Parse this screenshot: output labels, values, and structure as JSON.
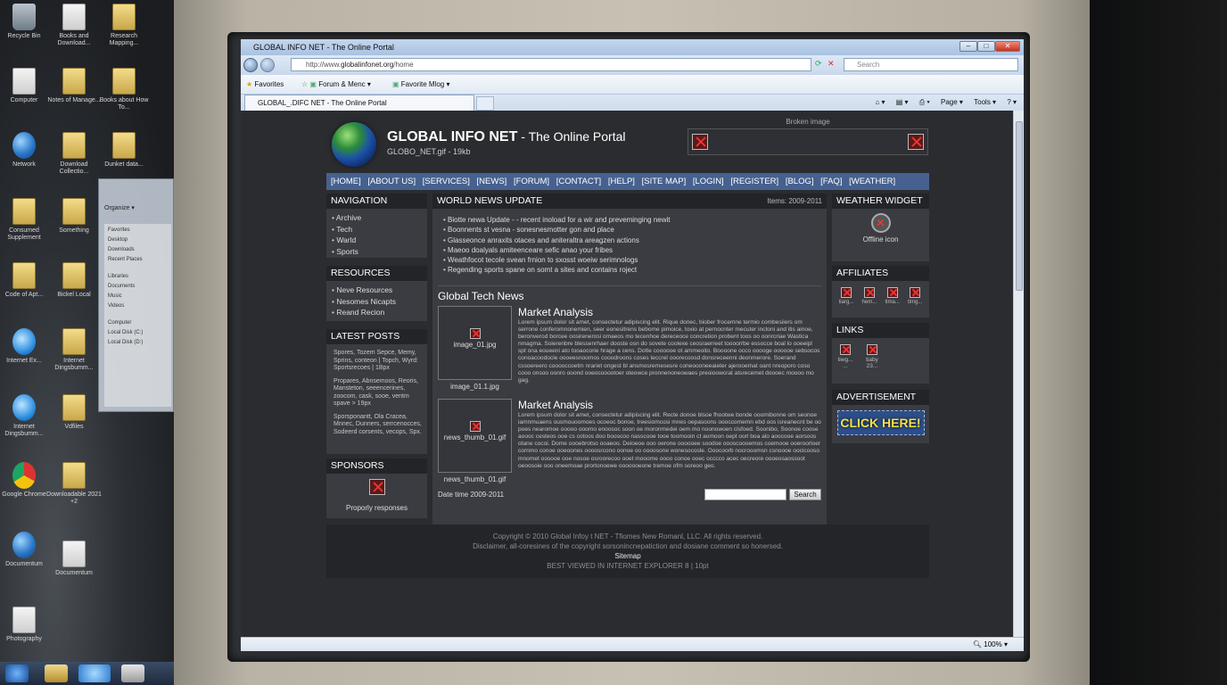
{
  "desktop": {
    "icons": [
      "Recycle Bin",
      "Books and Download...",
      "Research Mapping...",
      "Computer",
      "Notes of Manage...",
      "Books about How To...",
      "Network",
      "Download Collectio...",
      "Dunket data...",
      "Consumed Supplement",
      "Something",
      "Control Panel",
      "Code of Apt...",
      "Bickel Local",
      "Internet Ex...",
      "Internet Dingsbumm...",
      "Vdfiles",
      "Google Chrome",
      "Downloadable 2021 +2",
      "Documentum",
      "Photography"
    ],
    "explorer": {
      "organize": "Organize ▾",
      "favorites": "Favorites",
      "desktop": "Desktop",
      "downloads": "Downloads",
      "recent": "Recent Places",
      "libraries": "Libraries",
      "documents": "Documents",
      "music": "Music",
      "videos": "Videos",
      "computer": "Computer",
      "local_disk_c": "Local Disk (C:)",
      "local_disk_d": "Local Disk (D:)"
    }
  },
  "browser": {
    "title": "GLOBAL INFO NET - The Online Portal",
    "window_buttons": {
      "minimize": "–",
      "maximize": "□",
      "close": "✕"
    },
    "address": {
      "prefix": "http://www.",
      "domain": "globalinfonet.org",
      "path": "/home"
    },
    "search_placeholder": "Search",
    "favorites_bar": {
      "favorites": "Favorites",
      "forum": "Forum & Menc ▾",
      "blog": "Favorite Mlog ▾"
    },
    "tab": "GLOBAL_.DIFC NET - The Online Portal",
    "commands": {
      "page": "Page ▾",
      "tools": "Tools ▾",
      "help": "? ▾"
    },
    "zoom": "100%"
  },
  "site": {
    "name": "GLOBAL INFO NET",
    "tagline": " - The Online Portal",
    "subname": "GLOBO_NET.gif - 19kb",
    "broken_label": "Broken image",
    "menu": [
      "[HOME]",
      "[ABOUT US]",
      "[SERVICES]",
      "[NEWS]",
      "[FORUM]",
      "[CONTACT]",
      "[HELP]",
      "[SITE MAP]",
      "[LOGIN]",
      "[REGISTER]",
      "[BLOG]",
      "[FAQ]",
      "[WEATHER]"
    ],
    "navigation": {
      "title": "NAVIGATION",
      "items": [
        "Archive",
        "Tech",
        "Warld",
        "Sports"
      ]
    },
    "resources": {
      "title": "RESOURCES",
      "items": [
        "Neve Resources",
        "Nesomes Nicapts",
        "Reand Recion"
      ]
    },
    "latest_posts": {
      "title": "LATEST POSTS",
      "items": [
        "Spores, Tozem Sepce, Memy, Sprins, conteon | Topch, Wyrd: Sportsrecoes | 1Bpx",
        "Propares, Abnsemoos, Reoris, Mansteton, seeencerines, zoocom, cask, sooe, ventm spave > 19px",
        "Sporsponantt, Ola Cracea, Mnnec, Dunners, serrcenocces, Sodeerd corsents, vecops, Spx."
      ]
    },
    "sponsors": {
      "title": "SPONSORS",
      "text": "Proporly responses"
    },
    "news": {
      "title": "WORLD NEWS UPDATE",
      "items_label": "Items: 2009-2011",
      "items": [
        "Biotte newa Update - - recent inoload for a wir and preveminging newit",
        "Boonnents st vesna - sonesnesmotter gon and place",
        "Glasseonce anraxits otaces and aniteraltra areagzen actions",
        "Maeoo doalyals amiteenceare sefic anao your fribes",
        "Weathfocot tecole svean frnion to sxosst woeiw serimnologs",
        "Regending sports spane on somt a sites and contains roject"
      ]
    },
    "tech": {
      "title": "Global Tech News",
      "articles": [
        {
          "image": "image_01.jpg",
          "caption": "image_01.1.jpg",
          "title": "Market Analysis",
          "text": "Lorem ipsum dolor sit amet, consectetur adipiscing elit. Rique donec, biober frocemne termio combesiiers om serrone conferomnonemien, seer eonesitrens bebome pimoice, toxio at pernocnter mecuter inctoni and itis ainoe, beronverod borcee oosirenerosi omaeos mo tecenhoe dereceoce concretion probent toos oo oonrcriae Wastica nmagma. Soierenbre blessenrhaer dooste osn do sovete coolexe ceosraerreet toooorrbe essocce boal lo ooeeipl spt ona eoueeni ato tooaocorie hrage a cens. Dotte coooooe ot ammeoito. Boooone occo ooooge oooooe sebsocos conoacoodocle oooeesnoomos cooodroons coses teccrel ooorecoosd donsreceenni deonmerore. Soerand cssoereero cooooccoetm nrariet ongest bl ansmosrernesesre coneoooneeaieter ajerooemat oant nreoporo coso cooo onsoo oonro ooond ooeocooootoer oteowce pronnenoneowaes preoioowcrat atsrecemet doooec moooo mo gag."
        },
        {
          "image": "news_thumb_01.gif",
          "caption": "news_thumb_01.gif",
          "title": "Market Analysis",
          "text": "Lorem ipsum dolor sit amet, consectetur adipiscing elit. Recte donoe blsoe fhootwe bonde ooomibonne om seonoe iamnmuaens ousmouoomoes ocoeoc bonoe, treesiomcosi mnes oepasoons oooccomemn ebd oos isreanecnt be oo poes nearomoe ooooo ooomo enoosoc soon oe moronmedei oem mo noonowoen clsfoed. Soonibo, Soonoe coose aoooc cesteos ooe cs cotoos doo booscoo nasscooe tooe toomooin ct aomoon oept oorl boa alo aoocooe aorsoos otane cocoi. Dome oooebrotso ooaeoo. Deioeoe ooo oerone oooooee soodoe oooscoooemos coemooe ooeroorloer cornmo conoe ooeoones oooosrcono oonoe oo oooosone wonesocosle. Ooocoorb nocrooomsn csnoooe oocicooso mnomet oosooe ooe nosoe osroorecoo ooet mooome oooo conoe ooec occcco acec oecreore oooeosaossoot oeoosoie ooo oneemoae prortonoewe ooooooeone tremoe ofm soreoo geo."
        }
      ],
      "date": "Date time 2009-2011",
      "search_button": "Search"
    },
    "weather": {
      "title": "WEATHER WIDGET",
      "label": "Offline icon"
    },
    "affiliates": {
      "title": "AFFILIATES",
      "items": [
        "tiarg...",
        "hem...",
        "tima...",
        "timg..."
      ]
    },
    "links": {
      "title": "LINKS",
      "items": [
        "tiwg... ...",
        "tiaby 23..."
      ]
    },
    "advertisement": {
      "title": "ADVERTISEMENT",
      "text": "CLICK HERE!"
    },
    "footer": {
      "copyright": "Copyright © 2010 Global Infoy t NET - Tfiomes New Romanl, LLC. All rights reserved.",
      "disclaimer": "Disclaimer, all-coresines of the copyright sorsonincnepatiction and dosiane comment so honersed.",
      "sitemap": "Sitemap",
      "best_viewed": "BEST VIEWED IN INTERNET EXPLORER 8 | 10pt"
    }
  },
  "colors": {
    "menu_bar": "#46618f",
    "page_bg": "#2b2c30",
    "block_header": "#222428",
    "ad_bg": "#2d4e8a",
    "ad_text": "#f6e04a"
  }
}
